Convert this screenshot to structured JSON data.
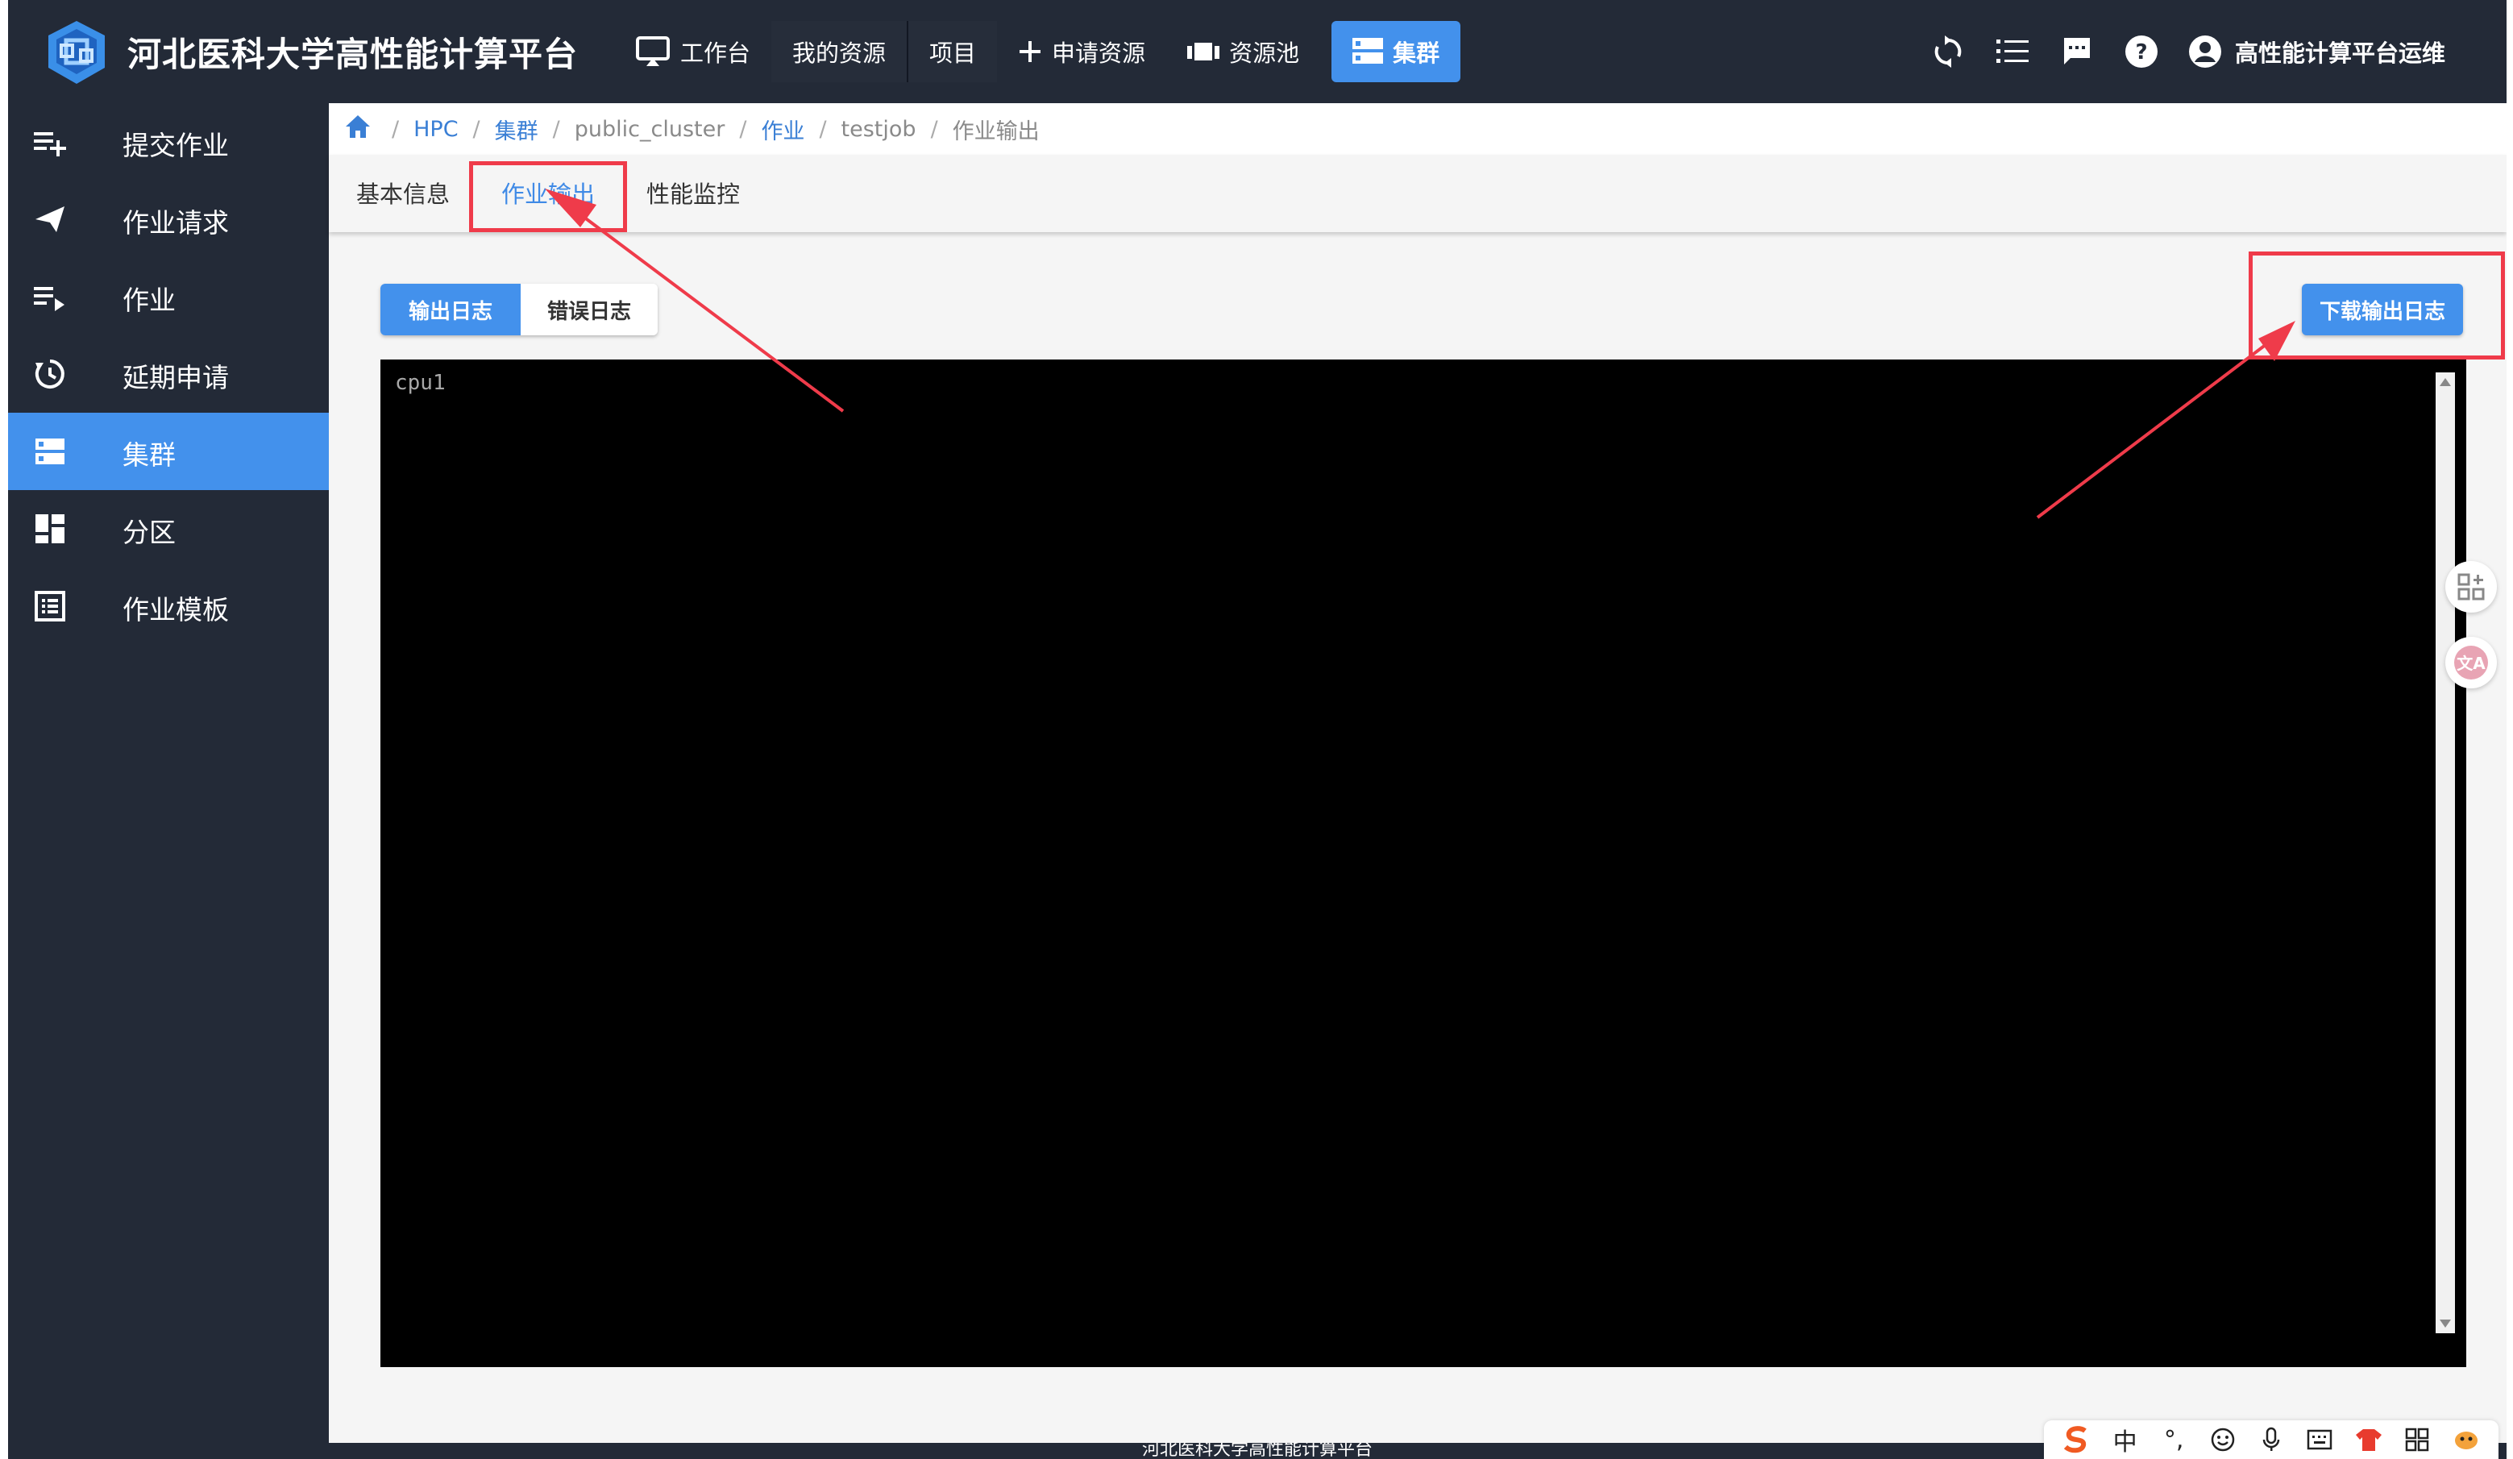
{
  "app": {
    "title": "河北医科大学高性能计算平台"
  },
  "nav": [
    {
      "label": "工作台",
      "icon": "monitor-icon"
    },
    {
      "label": "我的资源",
      "icon": ""
    },
    {
      "label": "项目",
      "icon": ""
    },
    {
      "label": "申请资源",
      "icon": "plus-icon"
    },
    {
      "label": "资源池",
      "icon": "pool-icon"
    },
    {
      "label": "集群",
      "icon": "server-icon",
      "active": true
    }
  ],
  "user": {
    "name": "高性能计算平台运维"
  },
  "sidebar": {
    "items": [
      {
        "label": "提交作业",
        "icon": "playlist-add-icon"
      },
      {
        "label": "作业请求",
        "icon": "send-icon"
      },
      {
        "label": "作业",
        "icon": "playlist-play-icon"
      },
      {
        "label": "延期申请",
        "icon": "history-icon"
      },
      {
        "label": "集群",
        "icon": "server-icon",
        "active": true
      },
      {
        "label": "分区",
        "icon": "dashboard-icon"
      },
      {
        "label": "作业模板",
        "icon": "list-box-icon"
      }
    ]
  },
  "breadcrumb": [
    "HPC",
    "集群",
    "public_cluster",
    "作业",
    "testjob",
    "作业输出"
  ],
  "tabs": [
    "基本信息",
    "作业输出",
    "性能监控"
  ],
  "active_tab": "作业输出",
  "log_buttons": {
    "output": "输出日志",
    "error": "错误日志"
  },
  "download_button": "下载输出日志",
  "console": {
    "text": "cpu1"
  },
  "footer": {
    "text": "河北医科大学高性能计算平台"
  },
  "ime": {
    "mode": "中",
    "punct": "°,"
  },
  "colors": {
    "topbar": "#232a37",
    "accent": "#4391ec",
    "annotation": "#ef3b4a",
    "console_bg": "#000000"
  }
}
